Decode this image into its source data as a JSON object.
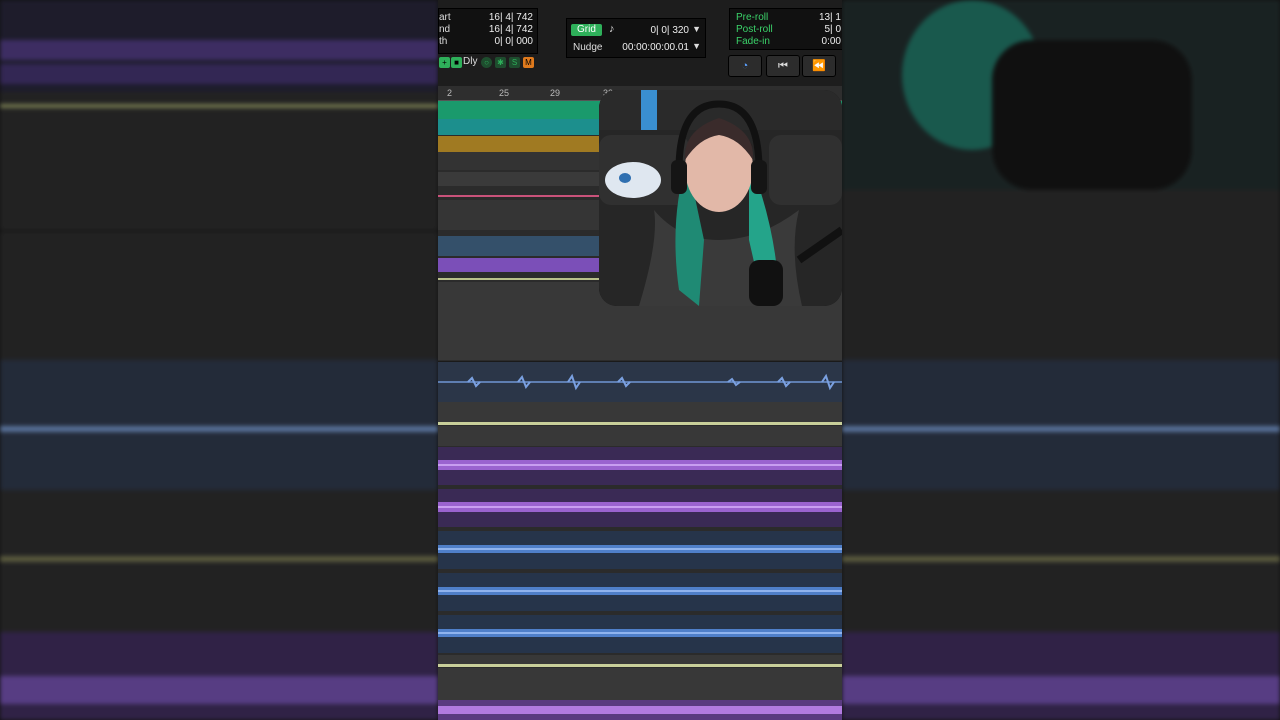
{
  "counter": {
    "rows": [
      {
        "label": "art",
        "value": "16| 4| 742"
      },
      {
        "label": "nd",
        "value": "16| 4| 742"
      },
      {
        "label": "th",
        "value": "0| 0| 000"
      }
    ],
    "dly_label": "Dly",
    "m_label": "M"
  },
  "grid": {
    "label": "Grid",
    "value": "0| 0| 320",
    "nudge_label": "Nudge",
    "nudge_value": "00:00:00:00.01"
  },
  "roll": {
    "preroll_label": "Pre-roll",
    "preroll_value": "13| 1",
    "postroll_label": "Post-roll",
    "postroll_value": "5| 0",
    "fadein_label": "Fade-in",
    "fadein_value": "0:00"
  },
  "ruler": {
    "bars": [
      "2",
      "25",
      "29",
      "33"
    ]
  },
  "colors": {
    "track_teal": "#1c8f8d",
    "track_gold": "#a07a22",
    "track_pink": "#c9527a",
    "track_purple": "#7b4fb8",
    "wave_blue": "#4f7fc9",
    "wave_purple": "#9a63cf",
    "grid_green": "#2eb05a",
    "m_orange": "#e07a1d"
  }
}
